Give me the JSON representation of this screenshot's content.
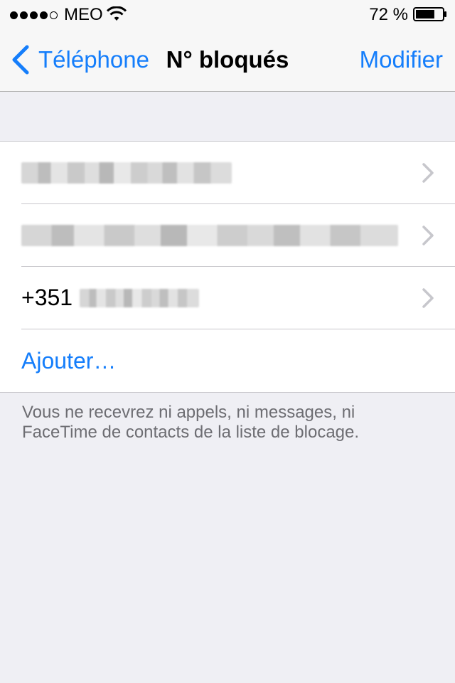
{
  "status_bar": {
    "carrier": "MEO",
    "signal_bars_filled": 4,
    "signal_bars_total": 5,
    "battery_percent": "72 %",
    "battery_level": 0.72
  },
  "nav": {
    "back_label": "Téléphone",
    "title": "N° bloqués",
    "edit_label": "Modifier"
  },
  "blocked_list": {
    "rows": [
      {
        "label": "",
        "redacted": true
      },
      {
        "label": "",
        "redacted": true
      },
      {
        "label": "+351",
        "redacted_suffix": true
      }
    ],
    "add_label": "Ajouter…"
  },
  "footer": {
    "note": "Vous ne recevrez ni appels, ni messages, ni FaceTime de contacts de la liste de blocage."
  },
  "colors": {
    "accent": "#157efb",
    "background": "#efeff4",
    "bar": "#f7f7f7",
    "separator": "#c8c7cc",
    "footer_text": "#6d6d72"
  },
  "icons": [
    "signal-dots-icon",
    "wifi-icon",
    "battery-icon",
    "chevron-left-icon",
    "chevron-right-icon"
  ]
}
